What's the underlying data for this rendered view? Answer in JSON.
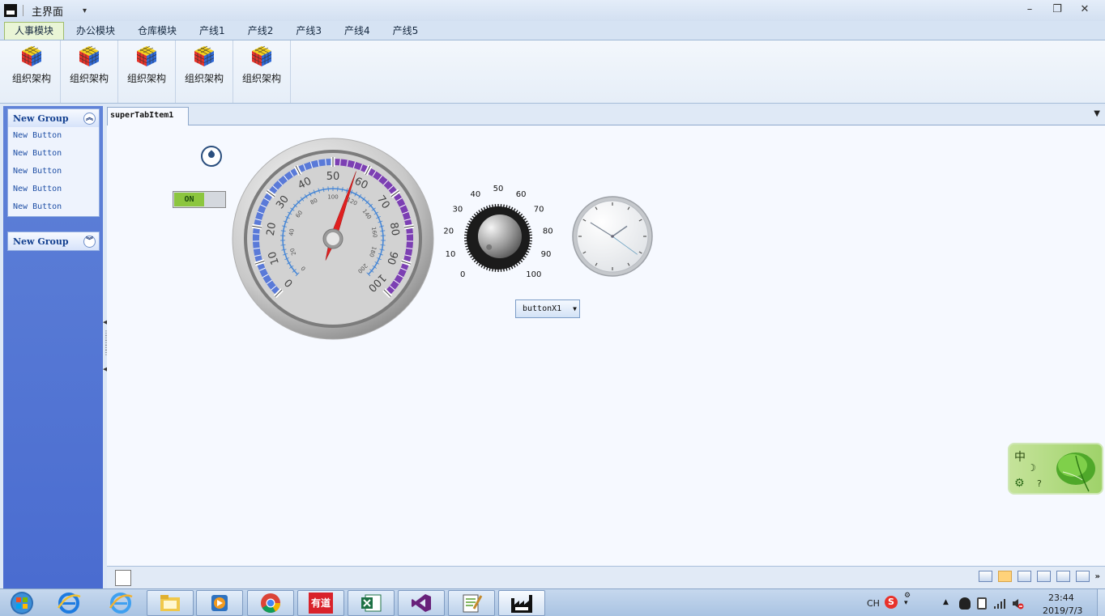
{
  "window": {
    "title": "主界面",
    "quick_access": "▾",
    "controls": [
      "–",
      "❐",
      "✕"
    ]
  },
  "ribbon": {
    "tabs": [
      {
        "label": "人事模块",
        "active": true
      },
      {
        "label": "办公模块"
      },
      {
        "label": "仓库模块"
      },
      {
        "label": "产线1"
      },
      {
        "label": "产线2"
      },
      {
        "label": "产线3"
      },
      {
        "label": "产线4"
      },
      {
        "label": "产线5"
      }
    ],
    "buttons": [
      {
        "label": "组织架构",
        "icon": "rubiks-cube-icon"
      },
      {
        "label": "组织架构",
        "icon": "rubiks-cube-icon"
      },
      {
        "label": "组织架构",
        "icon": "rubiks-cube-icon"
      },
      {
        "label": "组织架构",
        "icon": "rubiks-cube-icon"
      },
      {
        "label": "组织架构",
        "icon": "rubiks-cube-icon"
      }
    ]
  },
  "nav": {
    "groups": [
      {
        "title": "New Group",
        "expanded": true,
        "items": [
          "New Button",
          "New Button",
          "New Button",
          "New Button",
          "New Button"
        ]
      },
      {
        "title": "New Group",
        "expanded": false,
        "items": []
      }
    ]
  },
  "doc": {
    "tab_label": "superTabItem1",
    "switch_label": "ON",
    "dropdown_button_label": "buttonX1",
    "gauge": {
      "outer_scale": {
        "min": 0,
        "max": 100,
        "major_step": 10,
        "labels": [
          "0",
          "10",
          "20",
          "30",
          "40",
          "50",
          "60",
          "70",
          "80",
          "90",
          "100"
        ]
      },
      "inner_scale": {
        "min": 0,
        "max": 200,
        "major_step": 20,
        "labels": [
          "0",
          "20",
          "40",
          "60",
          "80",
          "100",
          "120",
          "140",
          "160",
          "180",
          "200"
        ]
      },
      "needle_value_outer": 57
    },
    "knob": {
      "labels": [
        "0",
        "10",
        "20",
        "30",
        "40",
        "50",
        "60",
        "70",
        "80",
        "90",
        "100"
      ],
      "value": 0
    },
    "clock": {
      "hour": 1,
      "minute": 50,
      "second": 21
    }
  },
  "ime": {
    "mode_char": "中",
    "moon": "☽",
    "gear": "⚙",
    "help": "?"
  },
  "taskbar": {
    "tray": {
      "lang": "CH",
      "time": "23:44",
      "date": "2019/7/3"
    },
    "apps": [
      "start-orb",
      "ie-icon",
      "ie-alt-icon",
      "explorer-icon",
      "media-icon",
      "chrome-icon",
      "youdao-icon",
      "excel-icon",
      "visual-studio-icon",
      "notepad-icon",
      "factory-app-icon"
    ],
    "youdao_label": "有道"
  },
  "colors": {
    "nav_blue": "#5273d4",
    "ribbon_tab_active": "#e9f5d6",
    "switch_green": "#8cc63f",
    "needle_red": "#e02020",
    "band_purple": "#7c3fb3",
    "band_blue": "#5a7ad8"
  }
}
